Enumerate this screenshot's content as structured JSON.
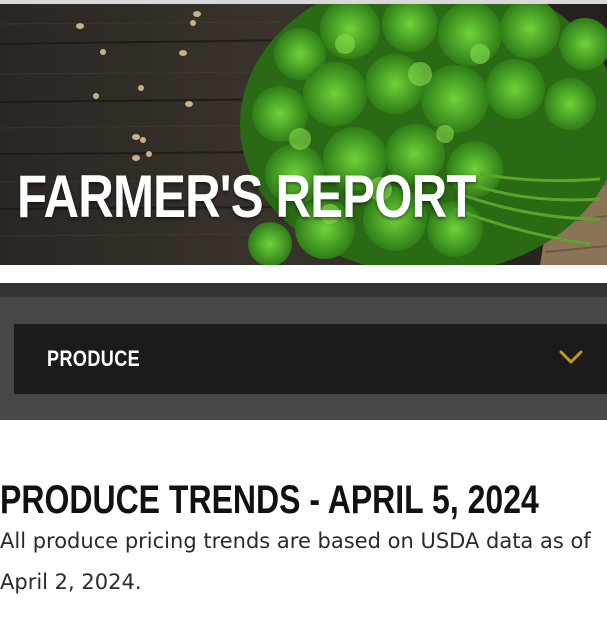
{
  "hero": {
    "title": "FARMER'S REPORT",
    "image": "cilantro-on-wooden-table"
  },
  "category_dropdown": {
    "selected": "PRODUCE",
    "icon": "chevron-down-icon",
    "accent_color": "#c8961e"
  },
  "content": {
    "heading": "PRODUCE TRENDS - APRIL 5, 2024",
    "description": "All produce pricing trends are based on USDA data as of April 2, 2024."
  },
  "colors": {
    "panel_background": "#474747",
    "dropdown_background": "#1b1b1b"
  }
}
